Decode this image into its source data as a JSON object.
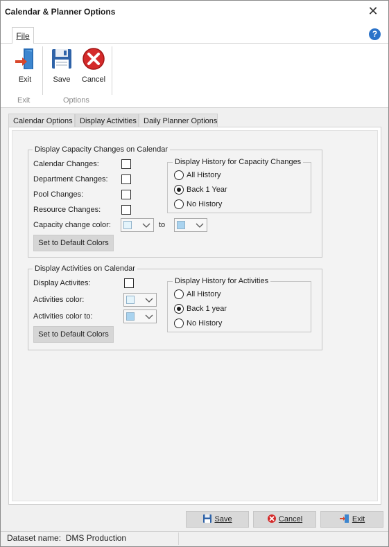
{
  "window": {
    "title": "Calendar & Planner Options"
  },
  "ribbon_tabs": {
    "file": "File"
  },
  "ribbon": {
    "exit_label": "Exit",
    "save_label": "Save",
    "cancel_label": "Cancel",
    "group_exit": "Exit",
    "group_options": "Options"
  },
  "tabs": [
    "Calendar Options",
    "Display Activities",
    "Daily Planner Options"
  ],
  "capacity": {
    "legend": "Display Capacity Changes on Calendar",
    "calendar_changes": "Calendar Changes:",
    "department_changes": "Department Changes:",
    "pool_changes": "Pool Changes:",
    "resource_changes": "Resource Changes:",
    "color_label": "Capacity change color:",
    "to_label": "to",
    "default_button": "Set to Default Colors",
    "history_legend": "Display History for Capacity Changes",
    "history_options": [
      "All History",
      "Back 1 Year",
      "No History"
    ],
    "history_selected": 1,
    "color_from": "#e4f4fb",
    "color_to": "#a9d3ef"
  },
  "activities": {
    "legend": "Display Activities on Calendar",
    "display_label": "Display Activites:",
    "color_label": "Activities color:",
    "color_to_label": "Activities color to:",
    "default_button": "Set to Default Colors",
    "history_legend": "Display History for Activities",
    "history_options": [
      "All History",
      "Back 1 year",
      "No History"
    ],
    "history_selected": 1,
    "color_from": "#e4f4fb",
    "color_to": "#a9d3ef"
  },
  "footer": {
    "save": "Save",
    "cancel": "Cancel",
    "exit": "Exit"
  },
  "status": {
    "dataset": "Dataset name:  DMS Production"
  }
}
